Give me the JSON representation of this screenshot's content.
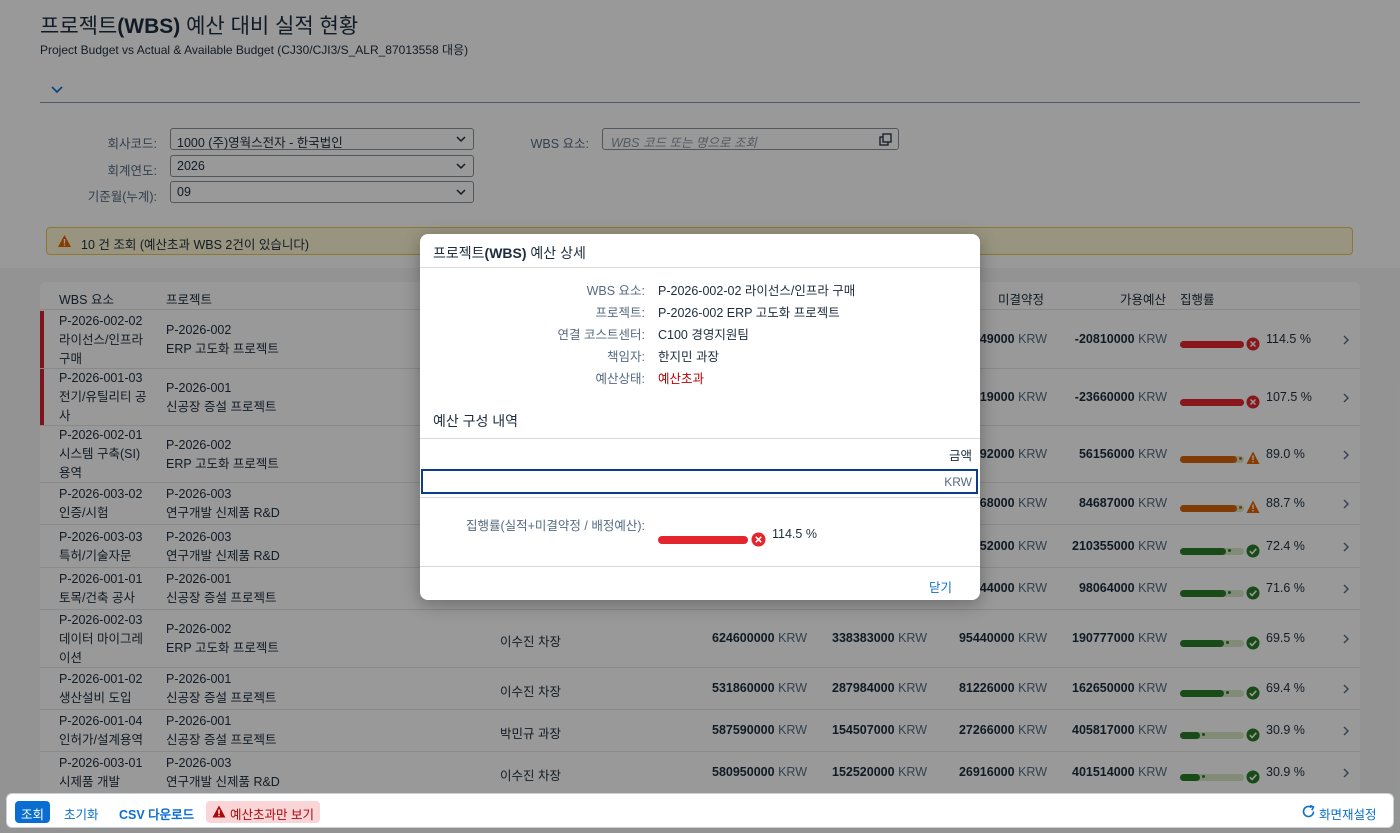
{
  "page": {
    "title_prefix": "프로젝트",
    "title_bold": "(WBS)",
    "title_suffix": " 예산 대비 실적 현황",
    "subtitle": "Project Budget vs Actual & Available Budget (CJ30/CJI3/S_ALR_87013558 대응)"
  },
  "filters": {
    "company_label": "회사코드:",
    "company_value": "1000 (주)영웍스전자 - 한국법인",
    "year_label": "회계연도:",
    "year_value": "2026",
    "period_label": "기준월(누계):",
    "period_value": "09",
    "wbs_label": "WBS 요소:",
    "wbs_placeholder": "WBS 코드 또는 명으로 조회"
  },
  "message": {
    "text": "10 건 조회 (예산초과 WBS 2건이 있습니다)"
  },
  "table": {
    "headers": {
      "wbs": "WBS 요소",
      "project": "프로젝트",
      "commit": "미결약정",
      "avail": "가용예산",
      "rate": "집행률"
    },
    "unit": "KRW",
    "rows": [
      {
        "wbs1": "P-2026-002-02",
        "wbs2": "라이선스/인프라",
        "wbs3": "구매",
        "proj1": "P-2026-002",
        "proj2": "ERP 고도화 프로젝트",
        "mgr": "",
        "budget": "",
        "actual": "",
        "commit": "049000",
        "avail": "-20810000",
        "pct_label": "114.5 %",
        "rate": 114.5,
        "status": "error",
        "over": true
      },
      {
        "wbs1": "P-2026-001-03",
        "wbs2": "전기/유틸리티 공",
        "wbs3": "사",
        "proj1": "P-2026-001",
        "proj2": "신공장 증설 프로젝트",
        "mgr": "",
        "budget": "",
        "actual": "",
        "commit": "519000",
        "avail": "-23660000",
        "pct_label": "107.5 %",
        "rate": 107.5,
        "status": "error",
        "over": true
      },
      {
        "wbs1": "P-2026-002-01",
        "wbs2": "시스템 구축(SI)",
        "wbs3": "용역",
        "proj1": "P-2026-002",
        "proj2": "ERP 고도화 프로젝트",
        "mgr": "",
        "budget": "",
        "actual": "",
        "commit": "992000",
        "avail": "56156000",
        "pct_label": "89.0 %",
        "rate": 89.0,
        "status": "warning",
        "over": false
      },
      {
        "wbs1": "P-2026-003-02",
        "wbs2": "인증/시험",
        "wbs3": "",
        "proj1": "P-2026-003",
        "proj2": "연구개발 신제품 R&D",
        "mgr": "",
        "budget": "",
        "actual": "",
        "commit": "768000",
        "avail": "84687000",
        "pct_label": "88.7 %",
        "rate": 88.7,
        "status": "warning",
        "over": false
      },
      {
        "wbs1": "P-2026-003-03",
        "wbs2": "특허/기술자문",
        "wbs3": "",
        "proj1": "P-2026-003",
        "proj2": "연구개발 신제품 R&D",
        "mgr": "",
        "budget": "",
        "actual": "",
        "commit": "252000",
        "avail": "210355000",
        "pct_label": "72.4 %",
        "rate": 72.4,
        "status": "success",
        "over": false
      },
      {
        "wbs1": "P-2026-001-01",
        "wbs2": "토목/건축 공사",
        "wbs3": "",
        "proj1": "P-2026-001",
        "proj2": "신공장 증설 프로젝트",
        "mgr": "",
        "budget": "",
        "actual": "",
        "commit": "444000",
        "avail": "98064000",
        "pct_label": "71.6 %",
        "rate": 71.6,
        "status": "success",
        "over": false
      },
      {
        "wbs1": "P-2026-002-03",
        "wbs2": "데이터 마이그레",
        "wbs3": "이션",
        "proj1": "P-2026-002",
        "proj2": "ERP 고도화 프로젝트",
        "mgr": "이수진 차장",
        "budget": "624600000",
        "actual": "338383000",
        "commit": "95440000",
        "avail": "190777000",
        "pct_label": "69.5 %",
        "rate": 69.5,
        "status": "success",
        "over": false
      },
      {
        "wbs1": "P-2026-001-02",
        "wbs2": "생산설비 도입",
        "wbs3": "",
        "proj1": "P-2026-001",
        "proj2": "신공장 증설 프로젝트",
        "mgr": "이수진 차장",
        "budget": "531860000",
        "actual": "287984000",
        "commit": "81226000",
        "avail": "162650000",
        "pct_label": "69.4 %",
        "rate": 69.4,
        "status": "success",
        "over": false
      },
      {
        "wbs1": "P-2026-001-04",
        "wbs2": "인허가/설계용역",
        "wbs3": "",
        "proj1": "P-2026-001",
        "proj2": "신공장 증설 프로젝트",
        "mgr": "박민규 과장",
        "budget": "587590000",
        "actual": "154507000",
        "commit": "27266000",
        "avail": "405817000",
        "pct_label": "30.9 %",
        "rate": 30.9,
        "status": "success",
        "over": false
      },
      {
        "wbs1": "P-2026-003-01",
        "wbs2": "시제품 개발",
        "wbs3": "",
        "proj1": "P-2026-003",
        "proj2": "연구개발 신제품 R&D",
        "mgr": "이수진 차장",
        "budget": "580950000",
        "actual": "152520000",
        "commit": "26916000",
        "avail": "401514000",
        "pct_label": "30.9 %",
        "rate": 30.9,
        "status": "success",
        "over": false
      }
    ]
  },
  "footer": {
    "search": "조회",
    "reset": "초기화",
    "csv": "CSV 다운로드",
    "over_only": "예산초과만 보기",
    "screen_settings": "화면재설정"
  },
  "dialog": {
    "title_prefix": "프로젝트",
    "title_bold": "(WBS)",
    "title_suffix": " 예산 상세",
    "fields": [
      {
        "label": "WBS 요소:",
        "value": "P-2026-002-02 라이선스/인프라 구매"
      },
      {
        "label": "프로젝트:",
        "value": "P-2026-002 ERP 고도화 프로젝트"
      },
      {
        "label": "연결 코스트센터:",
        "value": "C100 경영지원팀"
      },
      {
        "label": "책임자:",
        "value": "한지민 과장"
      },
      {
        "label": "예산상태:",
        "value": "예산초과"
      }
    ],
    "section_title": "예산 구성 내역",
    "amount_header": "금액",
    "amount_unit": "KRW",
    "rate_label": "집행률(실적+미결약정 / 배정예산):",
    "rate_value": "114.5 %",
    "rate": 114.5,
    "close": "닫기"
  },
  "colors": {
    "accent": "#0a6ed1",
    "error": "#e3262d",
    "warning": "#d8630a",
    "success": "#2b7d2b"
  }
}
